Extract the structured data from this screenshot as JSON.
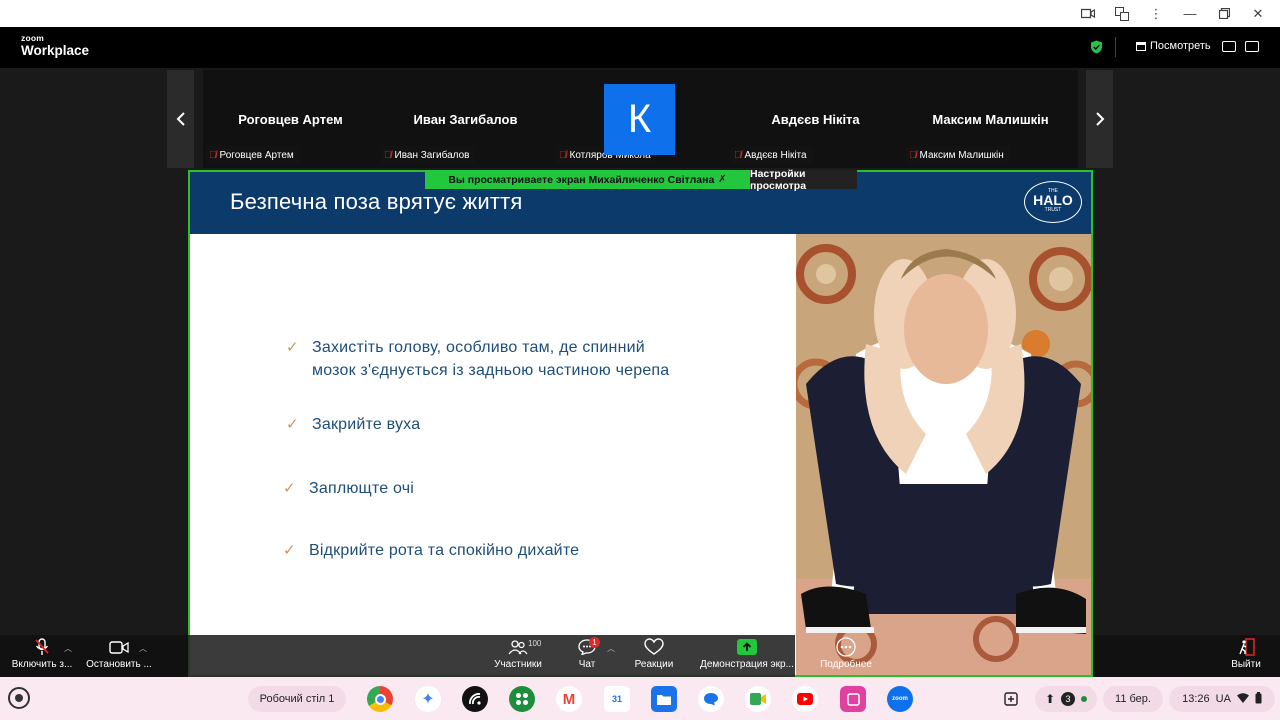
{
  "header": {
    "logo_small": "zoom",
    "logo_big": "Workplace",
    "view_label": "Посмотреть"
  },
  "participants": [
    {
      "display": "Роговцев Артем",
      "label": "Роговцев Артем"
    },
    {
      "display": "Иван Загибалов",
      "label": "Иван Загибалов"
    },
    {
      "display": "",
      "avatar": "К",
      "label": "Котляров Микола"
    },
    {
      "display": "Авдєєв Нікіта",
      "label": "Авдєєв Нікіта"
    },
    {
      "display": "Максим Малишкін",
      "label": "Максим Малишкін"
    }
  ],
  "share": {
    "banner": "Вы просматриваете экран  Михайличенко Світлана",
    "view_settings": "Настройки просмотра"
  },
  "slide": {
    "title": "Безпечна поза врятує життя",
    "logo_top": "THE",
    "logo_main": "HALO",
    "logo_bottom": "TRUST",
    "bullets": [
      {
        "line1": "Захистіть голову, особливо там, де спинний",
        "line2": "мозок з'єднується із задньою частиною черепа"
      },
      {
        "line1": "Закрийте вуха",
        "line2": ""
      },
      {
        "line1": "Заплющте очі",
        "line2": ""
      },
      {
        "line1": "Відкрийте рота та спокійно дихайте",
        "line2": ""
      }
    ]
  },
  "toolbar": {
    "mic_label": "Включить з...",
    "video_label": "Остановить ...",
    "participants_label": "Участники",
    "participants_count": "100",
    "chat_label": "Чат",
    "chat_badge": "1",
    "reactions_label": "Реакции",
    "share_label": "Демонстрация экр...",
    "more_label": "Подробнее",
    "leave_label": "Выйти"
  },
  "shelf": {
    "desk_label": "Робочий стіл 1",
    "notif_count": "3",
    "date": "11 бер.",
    "time": "13:26",
    "lang": "UA"
  },
  "colors": {
    "share_border": "#28c228",
    "slide_header": "#0c3a6b",
    "slide_text": "#1f4e79",
    "check": "#c8955a",
    "zoom_blue": "#0e71eb"
  }
}
